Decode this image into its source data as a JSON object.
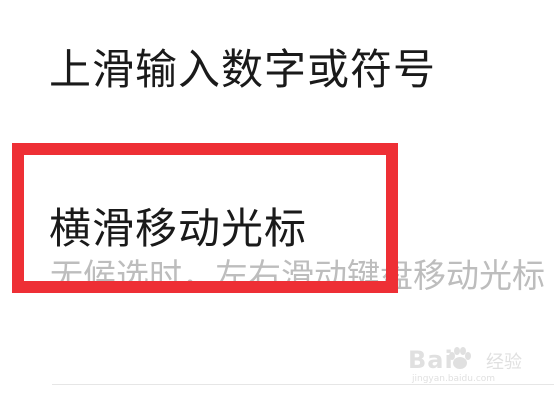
{
  "settings": {
    "items": [
      {
        "title": "上滑输入数字或符号"
      },
      {
        "title": "横滑移动光标",
        "subtitle": "无候选时，左右滑动键盘移动光标"
      }
    ]
  },
  "annotation": {
    "highlight_color": "#ee2f35"
  },
  "watermark": {
    "brand": "Bai",
    "brand_suffix": "经验",
    "domain": "jingyan.baidu.com",
    "icon": "baidu-paw-icon"
  }
}
